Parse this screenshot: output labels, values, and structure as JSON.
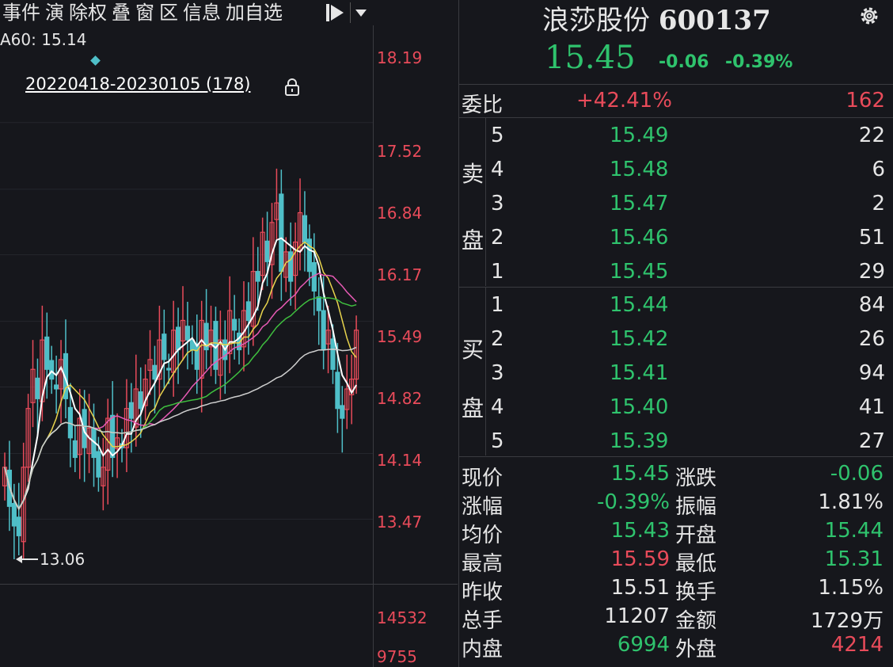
{
  "toolbar": {
    "items": [
      "事件",
      "演",
      "除权",
      "叠",
      "窗",
      "区",
      "信息",
      "加自选"
    ]
  },
  "chart": {
    "ma_label": "A60: 15.14",
    "range_label": "20220418-20230105 (178)",
    "low_label": "13.06",
    "price_ticks": [
      "18.19",
      "17.52",
      "16.84",
      "16.17",
      "15.49",
      "14.82",
      "14.14",
      "13.47"
    ],
    "volume_ticks": [
      "14532",
      "9755"
    ]
  },
  "quote": {
    "name": "浪莎股份",
    "code": "600137",
    "price": "15.45",
    "change": "-0.06",
    "change_pct": "-0.39%"
  },
  "ratio": {
    "label": "委比",
    "pct": "+42.41%",
    "diff": "162"
  },
  "sell": {
    "side": [
      "卖",
      "盘"
    ],
    "rows": [
      {
        "lvl": "5",
        "px": "15.49",
        "vol": "22"
      },
      {
        "lvl": "4",
        "px": "15.48",
        "vol": "6"
      },
      {
        "lvl": "3",
        "px": "15.47",
        "vol": "2"
      },
      {
        "lvl": "2",
        "px": "15.46",
        "vol": "51"
      },
      {
        "lvl": "1",
        "px": "15.45",
        "vol": "29"
      }
    ]
  },
  "buy": {
    "side": [
      "买",
      "盘"
    ],
    "rows": [
      {
        "lvl": "1",
        "px": "15.44",
        "vol": "84"
      },
      {
        "lvl": "2",
        "px": "15.42",
        "vol": "26"
      },
      {
        "lvl": "3",
        "px": "15.41",
        "vol": "94"
      },
      {
        "lvl": "4",
        "px": "15.40",
        "vol": "41"
      },
      {
        "lvl": "5",
        "px": "15.39",
        "vol": "27"
      }
    ]
  },
  "stats": {
    "left": [
      {
        "label": "现价",
        "value": "15.45",
        "color": "#2fc36d"
      },
      {
        "label": "涨幅",
        "value": "-0.39%",
        "color": "#2fc36d"
      },
      {
        "label": "均价",
        "value": "15.43",
        "color": "#2fc36d"
      },
      {
        "label": "最高",
        "value": "15.59",
        "color": "#e84b5a"
      },
      {
        "label": "昨收",
        "value": "15.51",
        "color": "#e6e6e6"
      },
      {
        "label": "总手",
        "value": "11207",
        "color": "#e6e6e6"
      },
      {
        "label": "内盘",
        "value": "6994",
        "color": "#2fc36d"
      }
    ],
    "right": [
      {
        "label": "涨跌",
        "value": "-0.06",
        "color": "#2fc36d"
      },
      {
        "label": "振幅",
        "value": "1.81%",
        "color": "#e6e6e6"
      },
      {
        "label": "开盘",
        "value": "15.44",
        "color": "#2fc36d"
      },
      {
        "label": "最低",
        "value": "15.31",
        "color": "#2fc36d"
      },
      {
        "label": "换手",
        "value": "1.15%",
        "color": "#e6e6e6"
      },
      {
        "label": "金额",
        "value": "1729万",
        "color": "#e6e6e6"
      },
      {
        "label": "外盘",
        "value": "4214",
        "color": "#e84b5a"
      }
    ]
  },
  "colors": {
    "up": "#e84b5a",
    "down": "#2fc36d",
    "cyan": "#4fbfc8",
    "bg": "#16171c"
  },
  "chart_data": {
    "type": "candlestick",
    "ylim": [
      13.06,
      18.19
    ],
    "low": 13.06,
    "closes": [
      14.0,
      13.6,
      13.4,
      13.3,
      14.0,
      14.6,
      15.0,
      14.7,
      15.3,
      15.0,
      14.9,
      14.8,
      15.1,
      14.7,
      14.3,
      14.1,
      14.5,
      14.2,
      14.4,
      14.1,
      13.9,
      14.0,
      14.5,
      14.1,
      14.3,
      14.2,
      14.6,
      14.5,
      14.8,
      14.6,
      14.9,
      15.1,
      14.9,
      15.3,
      15.1,
      15.0,
      15.4,
      15.2,
      15.5,
      15.3,
      15.2,
      15.0,
      15.5,
      15.2,
      15.4,
      15.0,
      15.3,
      15.1,
      15.6,
      15.4,
      15.2,
      15.6,
      15.5,
      16.0,
      15.9,
      16.4,
      16.1,
      16.5,
      16.7,
      16.0,
      16.2,
      15.9,
      16.3,
      16.6,
      16.3,
      16.0,
      15.8,
      15.6,
      15.2,
      15.4,
      15.0,
      14.6,
      14.5,
      14.8,
      14.9,
      15.4
    ]
  }
}
